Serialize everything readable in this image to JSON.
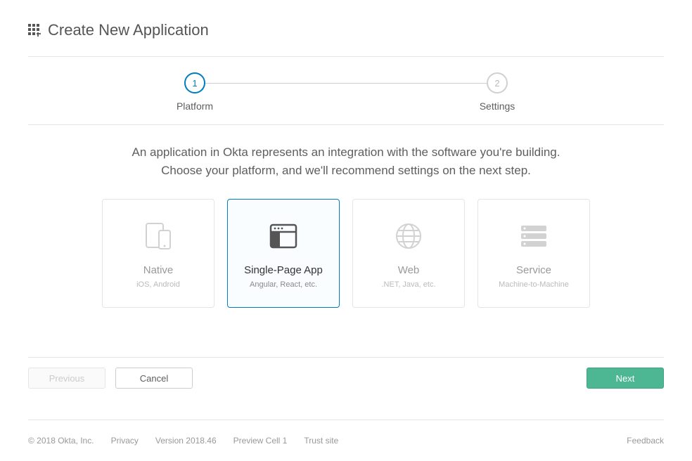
{
  "header": {
    "title": "Create New Application"
  },
  "stepper": {
    "steps": [
      {
        "number": "1",
        "label": "Platform",
        "active": true
      },
      {
        "number": "2",
        "label": "Settings",
        "active": false
      }
    ]
  },
  "description": {
    "line1": "An application in Okta represents an integration with the software you're building.",
    "line2": "Choose your platform, and we'll recommend settings on the next step."
  },
  "cards": [
    {
      "title": "Native",
      "subtitle": "iOS, Android",
      "selected": false,
      "icon": "native-icon"
    },
    {
      "title": "Single-Page App",
      "subtitle": "Angular, React, etc.",
      "selected": true,
      "icon": "spa-icon"
    },
    {
      "title": "Web",
      "subtitle": ".NET, Java, etc.",
      "selected": false,
      "icon": "web-icon"
    },
    {
      "title": "Service",
      "subtitle": "Machine-to-Machine",
      "selected": false,
      "icon": "service-icon"
    }
  ],
  "actions": {
    "previous": "Previous",
    "cancel": "Cancel",
    "next": "Next"
  },
  "footer": {
    "copyright": "© 2018 Okta, Inc.",
    "privacy": "Privacy",
    "version": "Version 2018.46",
    "cell": "Preview Cell 1",
    "trust": "Trust site",
    "feedback": "Feedback"
  }
}
